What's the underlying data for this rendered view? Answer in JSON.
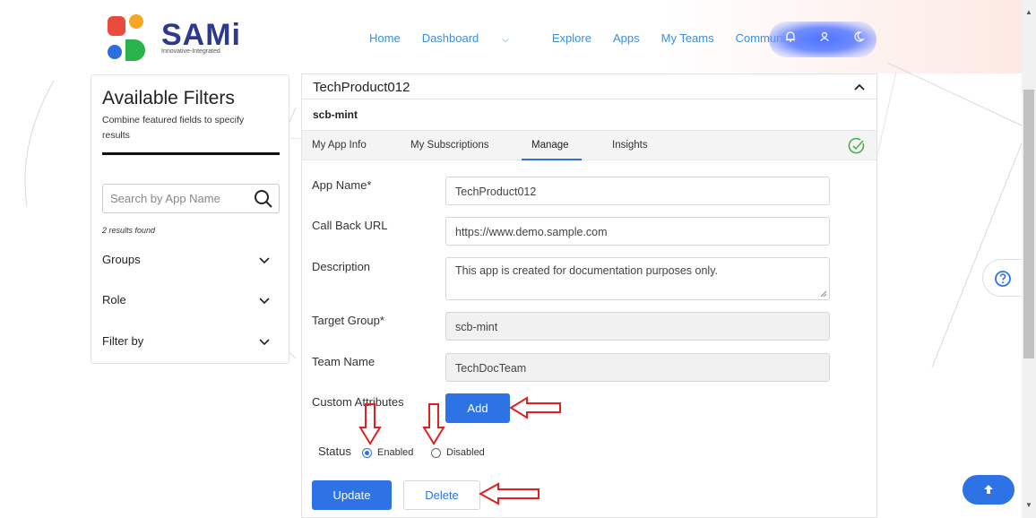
{
  "brand": {
    "name": "SAMi",
    "tagline": "Innovative-Integrated"
  },
  "nav": {
    "items": [
      {
        "label": "Home"
      },
      {
        "label": "Dashboard",
        "dropdown": true
      },
      {
        "label": "Explore"
      },
      {
        "label": "Apps"
      },
      {
        "label": "My Teams"
      },
      {
        "label": "Community",
        "dropdown": true
      }
    ],
    "icons": [
      "bell-icon",
      "user-icon",
      "moon-icon"
    ]
  },
  "filters": {
    "title": "Available Filters",
    "subtitle": "Combine featured fields to specify results",
    "search_placeholder": "Search by App Name",
    "results": "2 results found",
    "groups": [
      "Groups",
      "Role",
      "Filter by"
    ]
  },
  "app": {
    "title": "TechProduct012",
    "team_tab": "scb-mint",
    "tabs": [
      "My App Info",
      "My Subscriptions",
      "Manage",
      "Insights"
    ],
    "active_tab": "Manage",
    "form": {
      "app_name_label": "App Name*",
      "app_name_value": "TechProduct012",
      "callback_label": "Call Back URL",
      "callback_value": "https://www.demo.sample.com",
      "description_label": "Description",
      "description_value": "This app is created for documentation purposes only.",
      "target_group_label": "Target Group*",
      "target_group_value": "scb-mint",
      "team_name_label": "Team Name",
      "team_name_value": "TechDocTeam",
      "custom_attr_label": "Custom Attributes",
      "add_label": "Add",
      "status_label": "Status",
      "enabled_label": "Enabled",
      "disabled_label": "Disabled",
      "status_selected": "Enabled",
      "update_label": "Update",
      "delete_label": "Delete"
    }
  },
  "colors": {
    "accent": "#2d73e6",
    "annotation": "#e02020",
    "brand_text": "#2d3a8c"
  }
}
